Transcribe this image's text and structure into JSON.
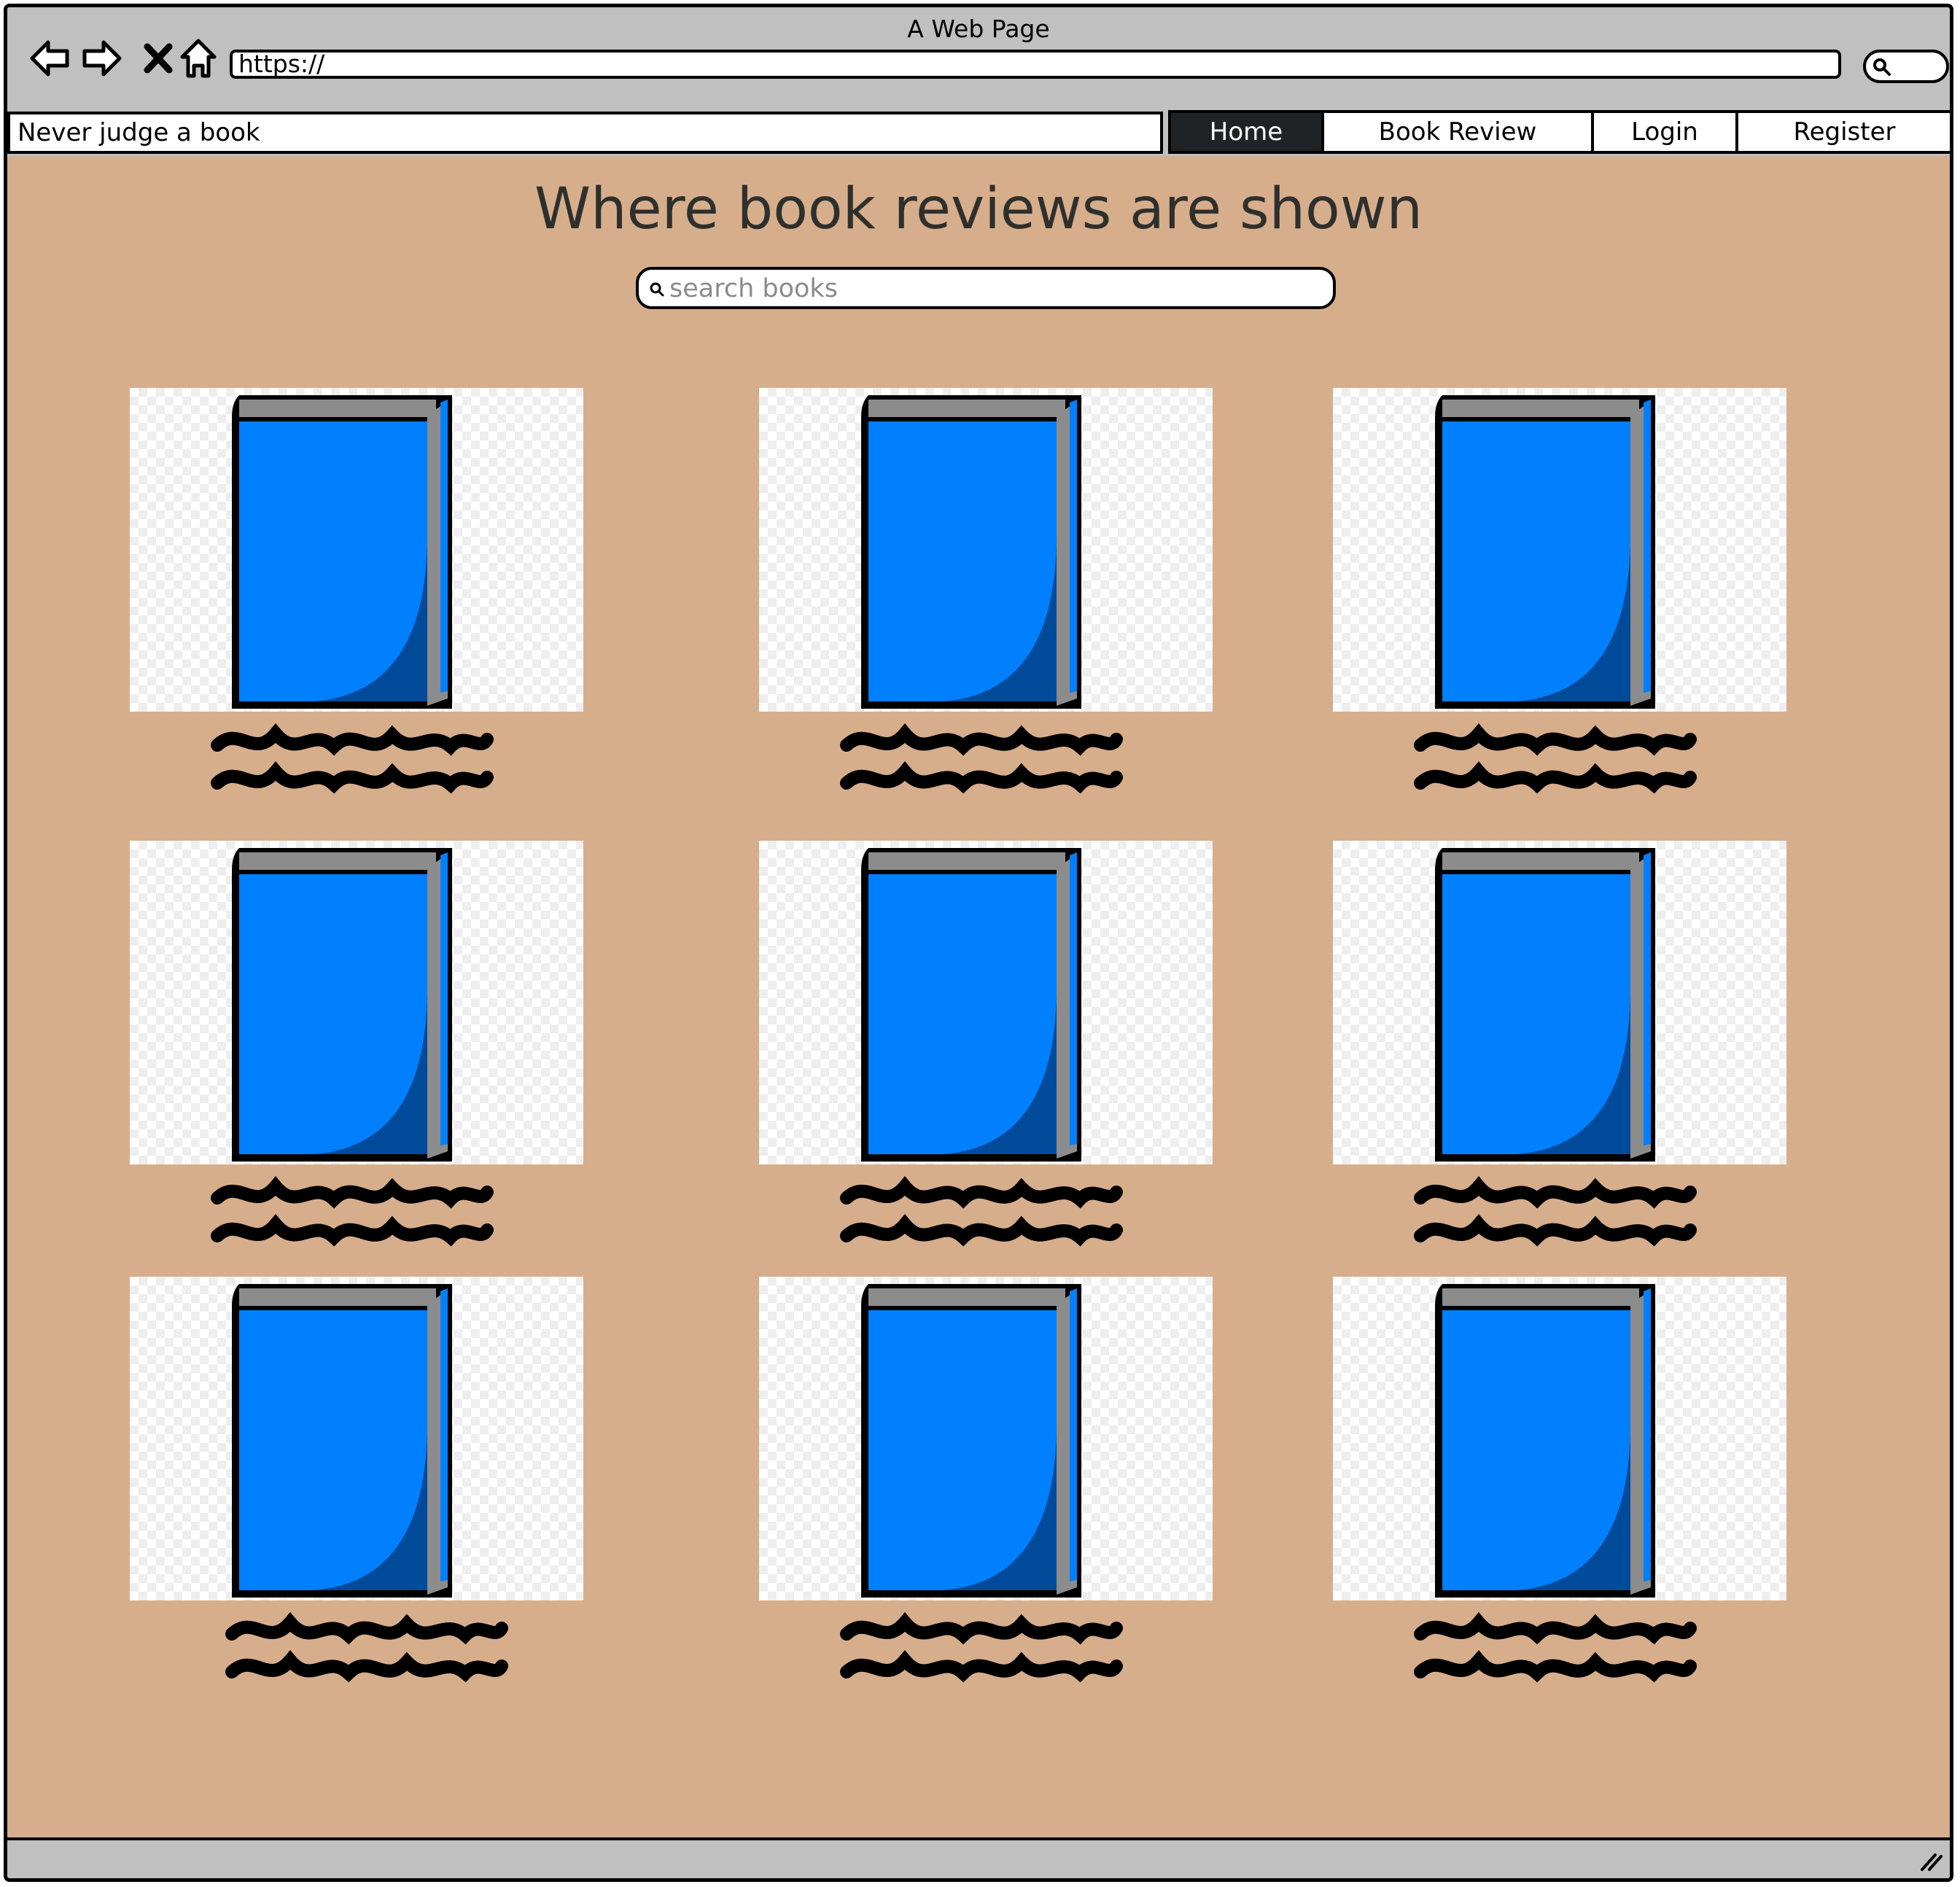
{
  "window": {
    "title": "A Web Page"
  },
  "toolbar": {
    "back": "back-arrow-icon",
    "forward": "forward-arrow-icon",
    "stop": "close-icon",
    "home": "home-icon",
    "url": "https://",
    "search": "search-icon"
  },
  "site": {
    "brand": "Never judge a book"
  },
  "nav": {
    "items": [
      {
        "label": "Home",
        "active": true
      },
      {
        "label": "Book Review",
        "active": false
      },
      {
        "label": "Login",
        "active": false
      },
      {
        "label": "Register",
        "active": false
      }
    ]
  },
  "main": {
    "heading": "Where book reviews are shown",
    "search_placeholder": "search books"
  },
  "books": {
    "count": 9,
    "cover_icon": "blue-book-icon",
    "caption": "scribbled placeholder text",
    "colors": {
      "cover": "#0080ff",
      "spine_shade": "#004a9a",
      "pages": "#8c8c8c"
    }
  },
  "colors": {
    "page_background": "#d7ae8b",
    "chrome": "#c0c0c0",
    "active_tab": "#202326",
    "heading": "#2e302d"
  }
}
